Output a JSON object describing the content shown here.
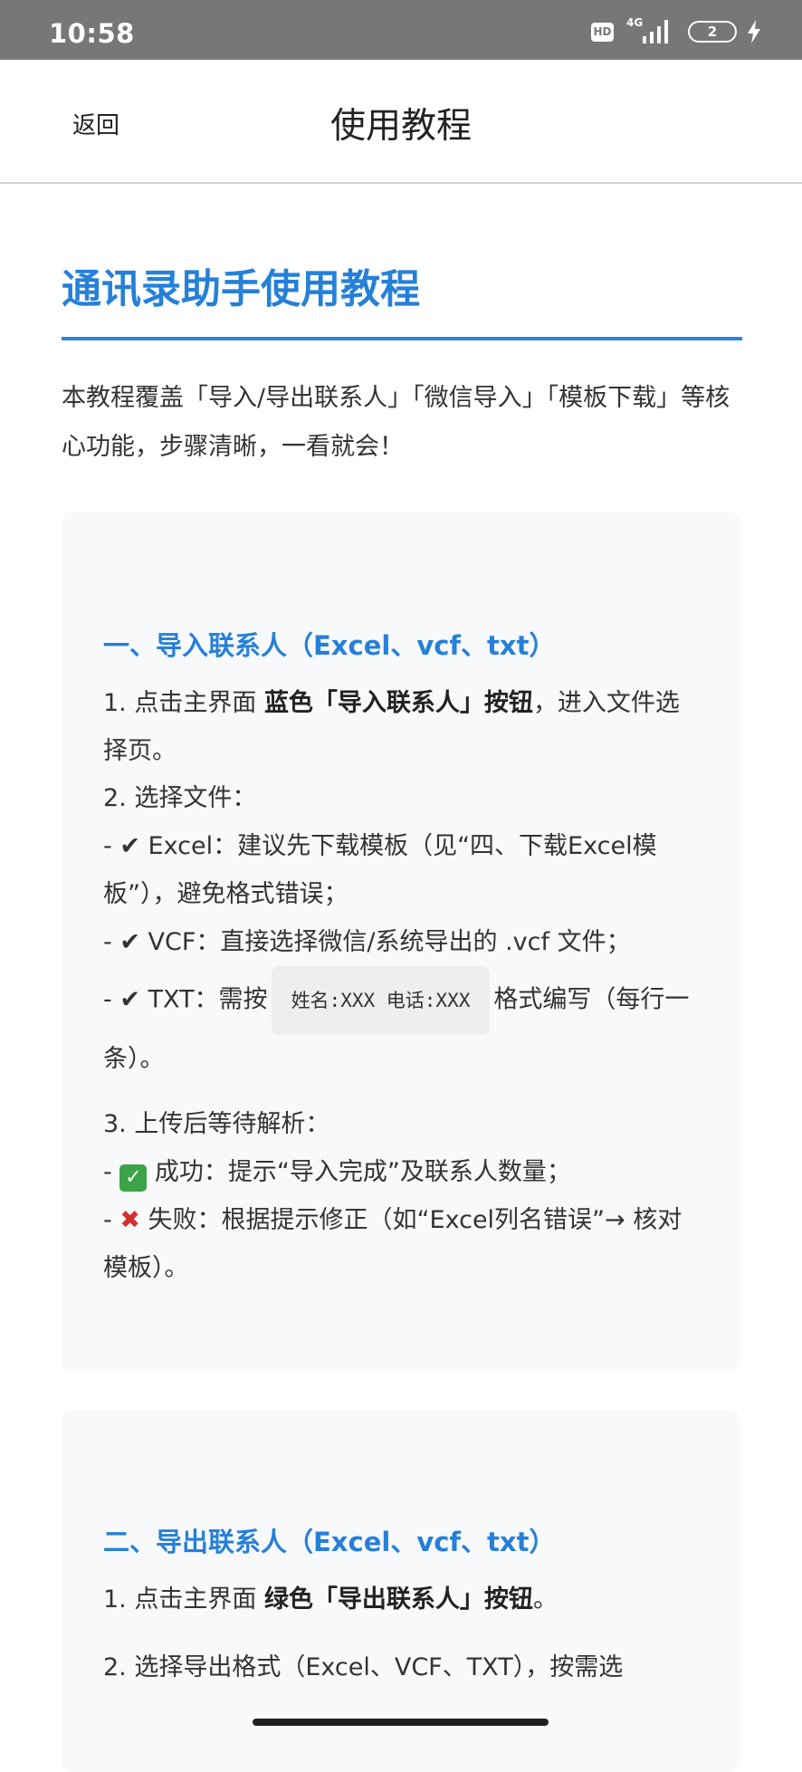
{
  "status_bar": {
    "time": "10:58",
    "hd_label": "HD",
    "network_label": "4G",
    "battery_level": "2"
  },
  "nav": {
    "back_label": "返回",
    "title": "使用教程"
  },
  "page": {
    "title": "通讯录助手使用教程",
    "intro": "本教程覆盖「导入/导出联系人」「微信导入」「模板下载」等核心功能，步骤清晰，一看就会！"
  },
  "section1": {
    "title": "一、导入联系人（Excel、vcf、txt）",
    "step1": {
      "pre": "1. 点击主界面 ",
      "bold": "蓝色「导入联系人」按钮",
      "post": "，进入文件选择页。"
    },
    "step2": {
      "heading": "2. 选择文件：",
      "excel": "Excel：建议先下载模板（见“四、下载Excel模板”），避免格式错误；",
      "vcf": "VCF：直接选择微信/系统导出的 .vcf 文件；",
      "txt_pre": "TXT：需按",
      "txt_code": "姓名:XXX 电话:XXX",
      "txt_post": "格式编写（每行一条）。"
    },
    "step3": {
      "heading": "3. 上传后等待解析：",
      "success": "成功：提示“导入完成”及联系人数量；",
      "fail": "失败：根据提示修正（如“Excel列名错误”→ 核对模板）。"
    }
  },
  "section2": {
    "title": "二、导出联系人（Excel、vcf、txt）",
    "step1": {
      "pre": "1. 点击主界面 ",
      "bold": "绿色「导出联系人」按钮",
      "post": "。"
    },
    "step2": "2. 选择导出格式（Excel、VCF、TXT），按需选"
  },
  "list_prefix": "- ",
  "marks": {
    "check": "✔",
    "ok": "✓",
    "fail": "✖"
  },
  "colors": {
    "accent": "#2680d8",
    "status_bar": "#777777",
    "card_bg": "#f8f9fb",
    "success": "#3ca348",
    "error": "#d3302f"
  }
}
